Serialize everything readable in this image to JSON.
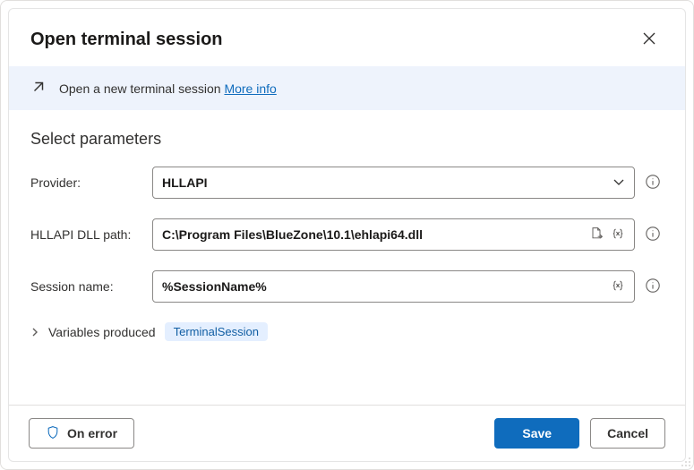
{
  "header": {
    "title": "Open terminal session"
  },
  "banner": {
    "text": "Open a new terminal session ",
    "link": "More info"
  },
  "section": {
    "title": "Select parameters"
  },
  "fields": {
    "provider": {
      "label": "Provider:",
      "value": "HLLAPI"
    },
    "dllpath": {
      "label": "HLLAPI DLL path:",
      "value": "C:\\Program Files\\BlueZone\\10.1\\ehlapi64.dll"
    },
    "session": {
      "label": "Session name:",
      "value": "%SessionName%"
    }
  },
  "vars": {
    "label": "Variables produced",
    "badge": "TerminalSession"
  },
  "footer": {
    "on_error": "On error",
    "save": "Save",
    "cancel": "Cancel"
  }
}
